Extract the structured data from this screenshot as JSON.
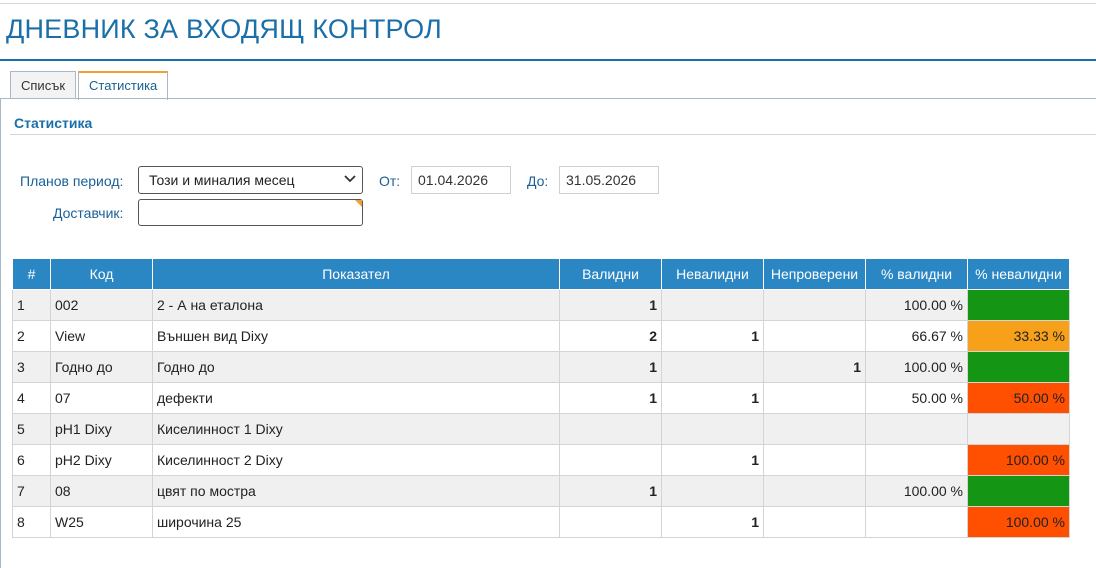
{
  "page": {
    "title": "ДНЕВНИК ЗА ВХОДЯЩ КОНТРОЛ"
  },
  "tabs": [
    {
      "label": "Списък",
      "active": false
    },
    {
      "label": "Статистика",
      "active": true
    }
  ],
  "section": {
    "title": "Статистика"
  },
  "filters": {
    "period_label": "Планов период:",
    "period_value": "Този и миналия месец",
    "from_label": "От:",
    "from_value": "01.04.2026",
    "to_label": "До:",
    "to_value": "31.05.2026",
    "supplier_label": "Доставчик:",
    "supplier_value": ""
  },
  "colors": {
    "header_bg": "#2a87c4",
    "good": "#149614",
    "warn": "#f7a11a",
    "bad": "#ff4f00"
  },
  "table": {
    "headers": [
      "#",
      "Код",
      "Показател",
      "Валидни",
      "Невалидни",
      "Непроверени",
      "% валидни",
      "% невалидни"
    ],
    "rows": [
      {
        "n": "1",
        "code": "002",
        "indicator": "2 - А на еталона",
        "valid": "1",
        "invalid": "",
        "unchecked": "",
        "pct_valid": "100.00 %",
        "pct_invalid": "",
        "status": "good"
      },
      {
        "n": "2",
        "code": "View",
        "indicator": "Външен вид Dixy",
        "valid": "2",
        "invalid": "1",
        "unchecked": "",
        "pct_valid": "66.67 %",
        "pct_invalid": "33.33 %",
        "status": "warn"
      },
      {
        "n": "3",
        "code": "Годно до",
        "indicator": "Годно до",
        "valid": "1",
        "invalid": "",
        "unchecked": "1",
        "pct_valid": "100.00 %",
        "pct_invalid": "",
        "status": "good"
      },
      {
        "n": "4",
        "code": "07",
        "indicator": "дефекти",
        "valid": "1",
        "invalid": "1",
        "unchecked": "",
        "pct_valid": "50.00 %",
        "pct_invalid": "50.00 %",
        "status": "bad"
      },
      {
        "n": "5",
        "code": "pH1 Dixy",
        "indicator": "Киселинност 1 Dixy",
        "valid": "",
        "invalid": "",
        "unchecked": "",
        "pct_valid": "",
        "pct_invalid": "",
        "status": "none"
      },
      {
        "n": "6",
        "code": "pH2 Dixy",
        "indicator": "Киселинност 2 Dixy",
        "valid": "",
        "invalid": "1",
        "unchecked": "",
        "pct_valid": "",
        "pct_invalid": "100.00 %",
        "status": "bad"
      },
      {
        "n": "7",
        "code": "08",
        "indicator": "цвят по мостра",
        "valid": "1",
        "invalid": "",
        "unchecked": "",
        "pct_valid": "100.00 %",
        "pct_invalid": "",
        "status": "good"
      },
      {
        "n": "8",
        "code": "W25",
        "indicator": "широчина 25",
        "valid": "",
        "invalid": "1",
        "unchecked": "",
        "pct_valid": "",
        "pct_invalid": "100.00 %",
        "status": "bad"
      }
    ]
  }
}
